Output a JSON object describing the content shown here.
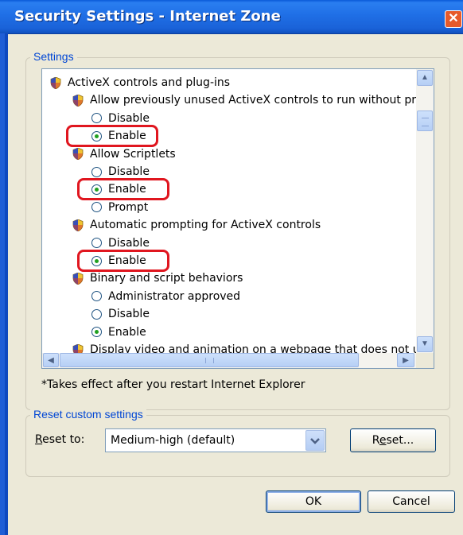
{
  "window": {
    "title": "Security Settings - Internet Zone",
    "close_glyph": "✕"
  },
  "settings_group": {
    "legend": "Settings"
  },
  "tree": {
    "items": [
      {
        "type": "category",
        "label": "ActiveX controls and plug-ins",
        "icon": "settings-shield-icon"
      },
      {
        "type": "setting",
        "label": "Allow previously unused ActiveX controls to run without prom",
        "icon": "settings-shield-icon"
      },
      {
        "type": "option",
        "label": "Disable",
        "checked": false
      },
      {
        "type": "option",
        "label": "Enable",
        "checked": true
      },
      {
        "type": "setting",
        "label": "Allow Scriptlets",
        "icon": "settings-shield-icon"
      },
      {
        "type": "option",
        "label": "Disable",
        "checked": false
      },
      {
        "type": "option",
        "label": "Enable",
        "checked": true
      },
      {
        "type": "option",
        "label": "Prompt",
        "checked": false
      },
      {
        "type": "setting",
        "label": "Automatic prompting for ActiveX controls",
        "icon": "settings-shield-icon"
      },
      {
        "type": "option",
        "label": "Disable",
        "checked": false
      },
      {
        "type": "option",
        "label": "Enable",
        "checked": true
      },
      {
        "type": "setting",
        "label": "Binary and script behaviors",
        "icon": "settings-shield-icon"
      },
      {
        "type": "option",
        "label": "Administrator approved",
        "checked": false
      },
      {
        "type": "option",
        "label": "Disable",
        "checked": false
      },
      {
        "type": "option",
        "label": "Enable",
        "checked": true
      },
      {
        "type": "setting",
        "label": "Display video and animation on a webpage that does not use",
        "icon": "settings-shield-icon"
      }
    ]
  },
  "note": "*Takes effect after you restart Internet Explorer",
  "reset_group": {
    "legend": "Reset custom settings",
    "reset_to_label": "Reset to:",
    "selected_level": "Medium-high (default)",
    "reset_button": "Reset..."
  },
  "buttons": {
    "ok": "OK",
    "cancel": "Cancel"
  },
  "colors": {
    "highlight_ring": "#e0161f",
    "legend_text": "#0046d5",
    "titlebar": "#1f6fe6"
  }
}
